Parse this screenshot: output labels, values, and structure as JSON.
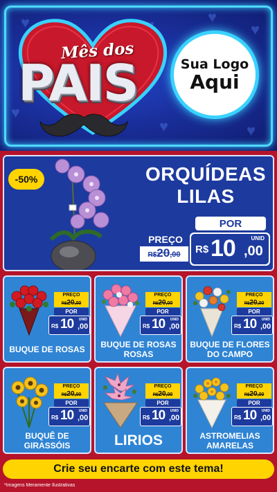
{
  "header": {
    "title_small": "Mês dos",
    "title_big": "PAIS",
    "logo_line1": "Sua Logo",
    "logo_line2": "Aqui"
  },
  "featured": {
    "discount": "-50%",
    "name_line1": "ORQUÍDEAS",
    "name_line2": "LILAS",
    "preco_label": "PREÇO",
    "old_currency": "R$",
    "old_int": "20",
    "old_dec": ",00",
    "por_label": "POR",
    "unid_label": "UNID",
    "new_currency": "R$",
    "new_int": "10",
    "new_dec": ",00"
  },
  "products": [
    {
      "name": "BUQUE DE ROSAS",
      "preco_label": "PREÇO",
      "old_currency": "R$",
      "old_int": "20",
      "old_dec": ",00",
      "por_label": "POR",
      "unid_label": "UNID",
      "new_currency": "R$",
      "new_int": "10",
      "new_dec": ",00"
    },
    {
      "name": "BUQUE DE ROSAS ROSAS",
      "preco_label": "PREÇO",
      "old_currency": "R$",
      "old_int": "20",
      "old_dec": ",00",
      "por_label": "POR",
      "unid_label": "UNID",
      "new_currency": "R$",
      "new_int": "10",
      "new_dec": ",00"
    },
    {
      "name": "BUQUE DE FLORES DO CAMPO",
      "preco_label": "PREÇO",
      "old_currency": "R$",
      "old_int": "20",
      "old_dec": ",00",
      "por_label": "POR",
      "unid_label": "UNID",
      "new_currency": "R$",
      "new_int": "10",
      "new_dec": ",00"
    },
    {
      "name": "BUQUÊ DE GIRASSÓIS",
      "preco_label": "PREÇO",
      "old_currency": "R$",
      "old_int": "20",
      "old_dec": ",00",
      "por_label": "POR",
      "unid_label": "UNID",
      "new_currency": "R$",
      "new_int": "10",
      "new_dec": ",00"
    },
    {
      "name": "LIRIOS",
      "preco_label": "PREÇO",
      "old_currency": "R$",
      "old_int": "20",
      "old_dec": ",00",
      "por_label": "POR",
      "unid_label": "UNID",
      "new_currency": "R$",
      "new_int": "10",
      "new_dec": ",00"
    },
    {
      "name": "ASTROMELIAS AMARELAS",
      "preco_label": "PREÇO",
      "old_currency": "R$",
      "old_int": "20",
      "old_dec": ",00",
      "por_label": "POR",
      "unid_label": "UNID",
      "new_currency": "R$",
      "new_int": "10",
      "new_dec": ",00"
    }
  ],
  "cta": {
    "label": "Crie seu encarte com este tema!"
  },
  "footer": {
    "disclaimer": "*Imagens Meramente Ilustrativas"
  },
  "colors": {
    "brand_red": "#b5142a",
    "brand_blue": "#1d3a9e",
    "card_blue": "#2f84d4",
    "accent_yellow": "#ffd400",
    "neon_cyan": "#39d2ff"
  }
}
